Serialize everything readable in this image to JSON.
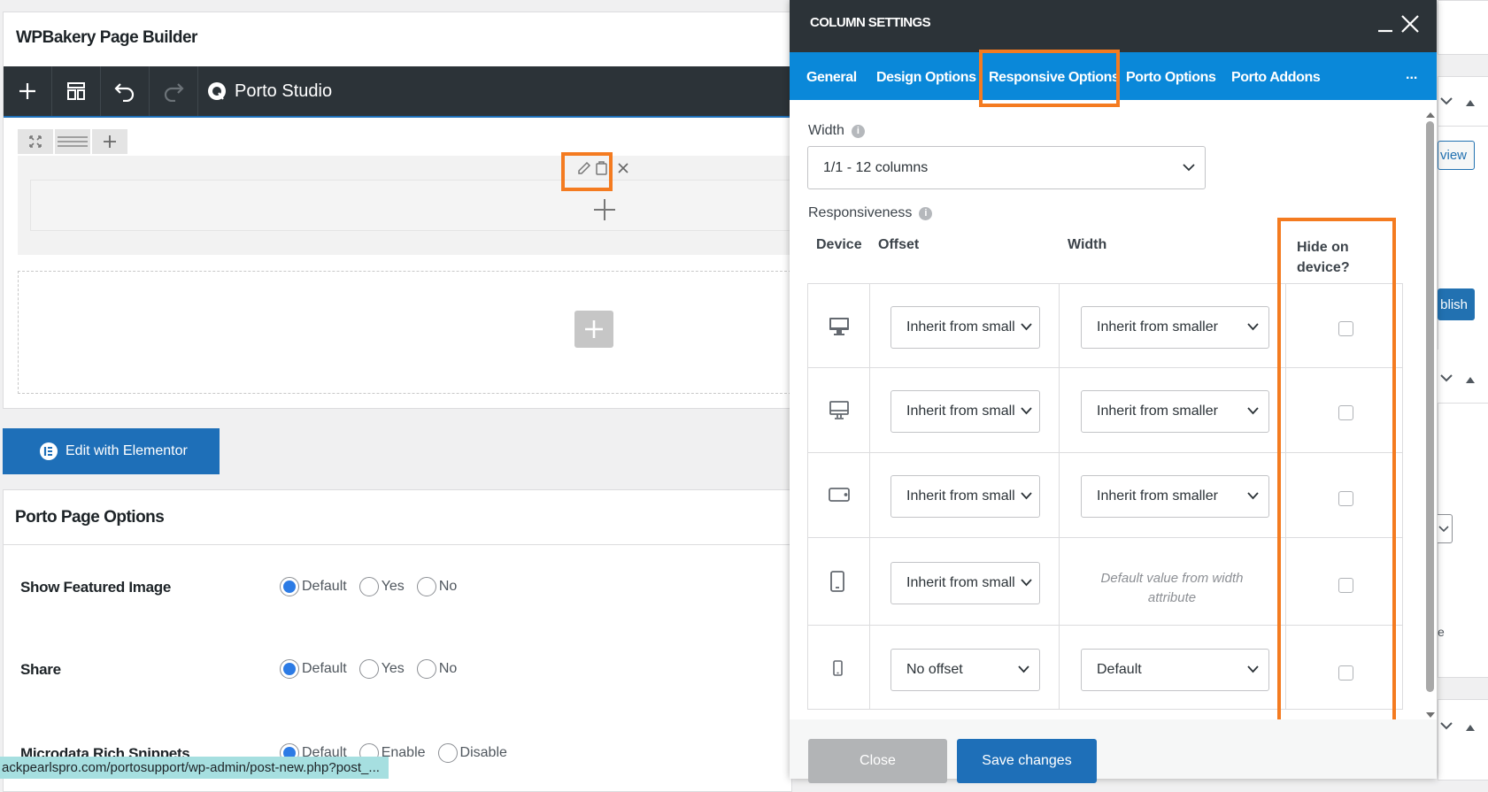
{
  "builder": {
    "title": "WPBakery Page Builder",
    "studio_label": "Porto Studio",
    "edit_elementor_label": "Edit with Elementor"
  },
  "porto_options": {
    "title": "Porto Page Options",
    "rows": [
      {
        "label": "Show Featured Image",
        "options": [
          "Default",
          "Yes",
          "No"
        ],
        "selected": "Default"
      },
      {
        "label": "Share",
        "options": [
          "Default",
          "Yes",
          "No"
        ],
        "selected": "Default"
      },
      {
        "label": "Microdata Rich Snippets",
        "options": [
          "Default",
          "Enable",
          "Disable"
        ],
        "selected": "Default"
      }
    ]
  },
  "status_url": "ackpearlspro.com/portosupport/wp-admin/post-new.php?post_...",
  "sidebar_fragments": {
    "view_btn": "view",
    "publish_btn": "blish",
    "text_e": "e"
  },
  "modal": {
    "title": "COLUMN SETTINGS",
    "tabs": [
      "General",
      "Design Options",
      "Responsive Options",
      "Porto Options",
      "Porto Addons"
    ],
    "active_tab": "Responsive Options",
    "more_label": "...",
    "width_label": "Width",
    "width_value": "1/1 - 12 columns",
    "responsiveness_label": "Responsiveness",
    "headers": {
      "device": "Device",
      "offset": "Offset",
      "width": "Width",
      "hide": "Hide on device?"
    },
    "rows": [
      {
        "device": "desktop-large",
        "offset": "Inherit from small",
        "width": "Inherit from smaller",
        "hidden": false
      },
      {
        "device": "desktop",
        "offset": "Inherit from small",
        "width": "Inherit from smaller",
        "hidden": false
      },
      {
        "device": "tablet-landscape",
        "offset": "Inherit from small",
        "width": "Inherit from smaller",
        "hidden": false
      },
      {
        "device": "tablet-portrait",
        "offset": "Inherit from small",
        "width": "Default value from width attribute",
        "hidden": false
      },
      {
        "device": "mobile",
        "offset": "No offset",
        "width": "Default",
        "hidden": false
      }
    ],
    "close_label": "Close",
    "save_label": "Save changes"
  },
  "colors": {
    "accent": "#0a88d9",
    "highlight": "#f47b20",
    "dark": "#2c3338",
    "primary_btn": "#1e6fb8"
  }
}
